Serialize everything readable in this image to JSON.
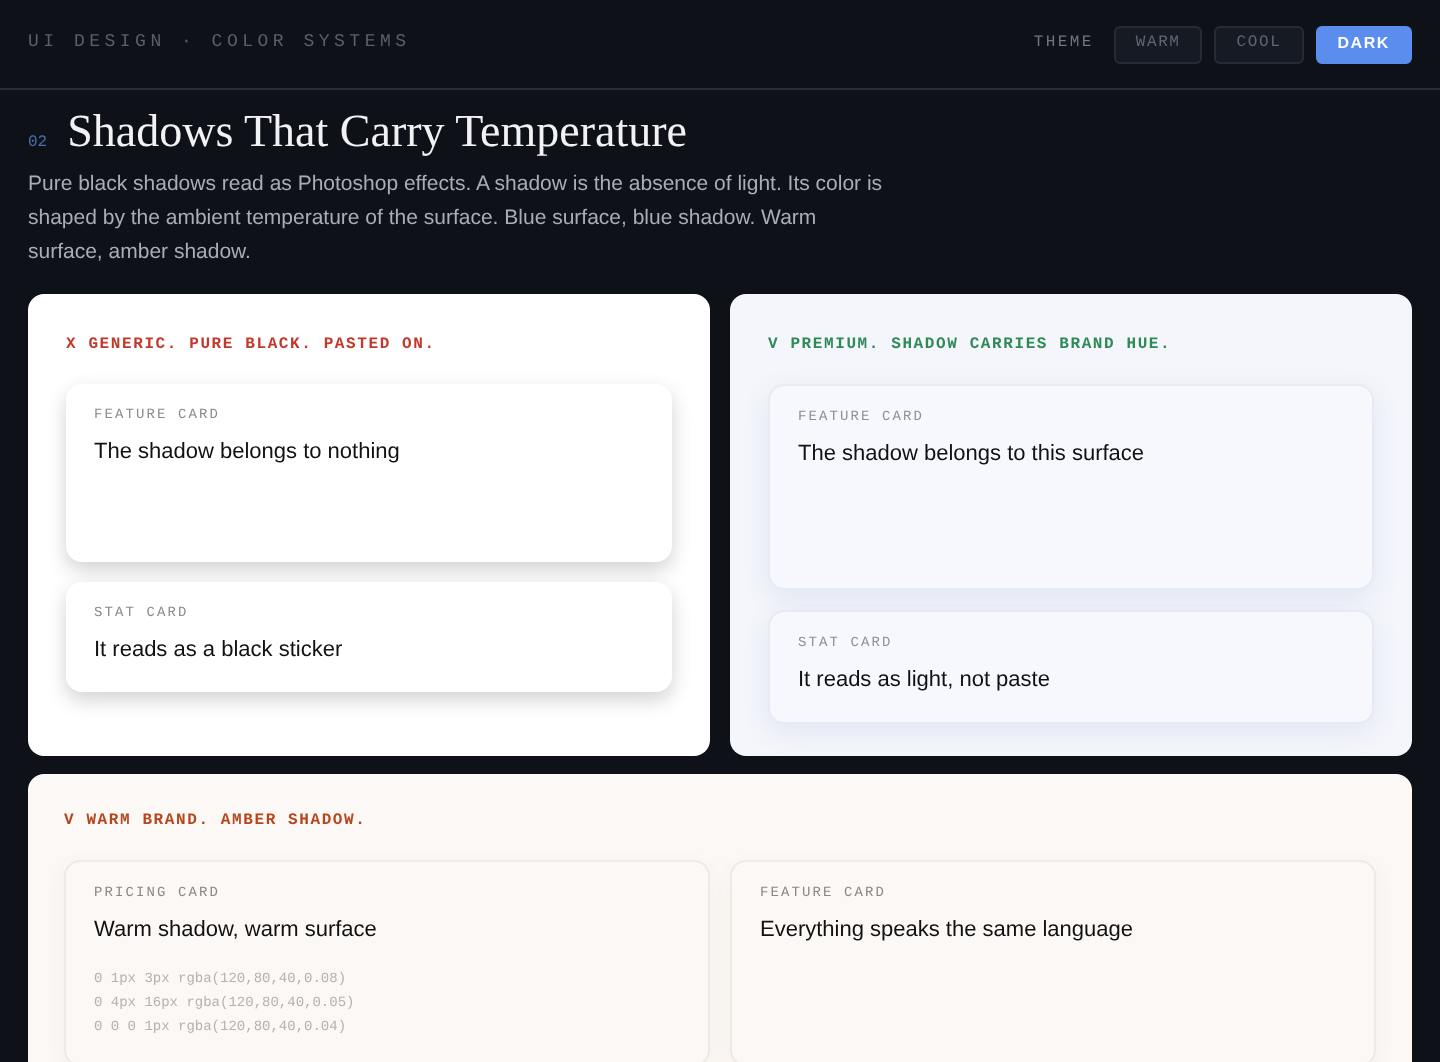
{
  "header": {
    "breadcrumb": "UI DESIGN · COLOR SYSTEMS",
    "theme_label": "THEME",
    "themes": [
      {
        "label": "WARM",
        "selected": false
      },
      {
        "label": "COOL",
        "selected": false
      },
      {
        "label": "DARK",
        "selected": true
      }
    ]
  },
  "section": {
    "number": "02",
    "title": "Shadows That Carry Temperature",
    "description": "Pure black shadows read as Photoshop effects. A shadow is the absence of light. Its color is shaped by the ambient temperature of the surface. Blue surface, blue shadow. Warm surface, amber shadow."
  },
  "panels": [
    {
      "kind": "black",
      "verdict": "X GENERIC. PURE BLACK. PASTED ON.",
      "cards": [
        {
          "label": "FEATURE CARD",
          "title": "The shadow belongs to nothing"
        },
        {
          "label": "STAT CARD",
          "title": "It reads as a black sticker"
        }
      ]
    },
    {
      "kind": "cool",
      "verdict": "V PREMIUM. SHADOW CARRIES BRAND HUE.",
      "cards": [
        {
          "label": "FEATURE CARD",
          "title": "The shadow belongs to this surface"
        },
        {
          "label": "STAT CARD",
          "title": "It reads as light, not paste"
        }
      ]
    },
    {
      "kind": "warm",
      "verdict": "V WARM BRAND. AMBER SHADOW.",
      "cards": [
        {
          "label": "PRICING CARD",
          "title": "Warm shadow, warm surface",
          "code": [
            "0 1px 3px rgba(120,80,40,0.08)",
            "0 4px 16px rgba(120,80,40,0.05)",
            "0 0 0 1px rgba(120,80,40,0.04)"
          ]
        },
        {
          "label": "FEATURE CARD",
          "title": "Everything speaks the same language"
        }
      ]
    }
  ]
}
